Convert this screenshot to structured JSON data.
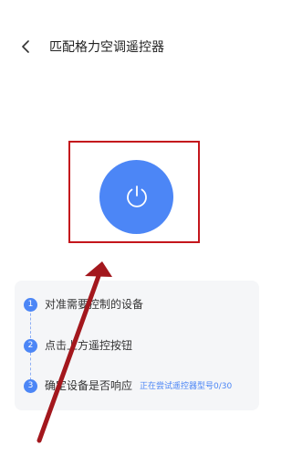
{
  "header": {
    "back_icon": "chevron-left-icon",
    "title": "匹配格力空调遥控器"
  },
  "power": {
    "icon": "power-icon"
  },
  "steps": [
    {
      "number": "1",
      "text": "对准需要控制的设备"
    },
    {
      "number": "2",
      "text": "点击上方遥控按钮"
    },
    {
      "number": "3",
      "text": "确定设备是否响应",
      "status": "正在尝试遥控器型号0/30"
    }
  ],
  "annotation": {
    "frame_color": "#c4161c",
    "arrow_color": "#a3171d"
  },
  "colors": {
    "accent": "#4c86f6",
    "card_bg": "#f5f6f8"
  }
}
